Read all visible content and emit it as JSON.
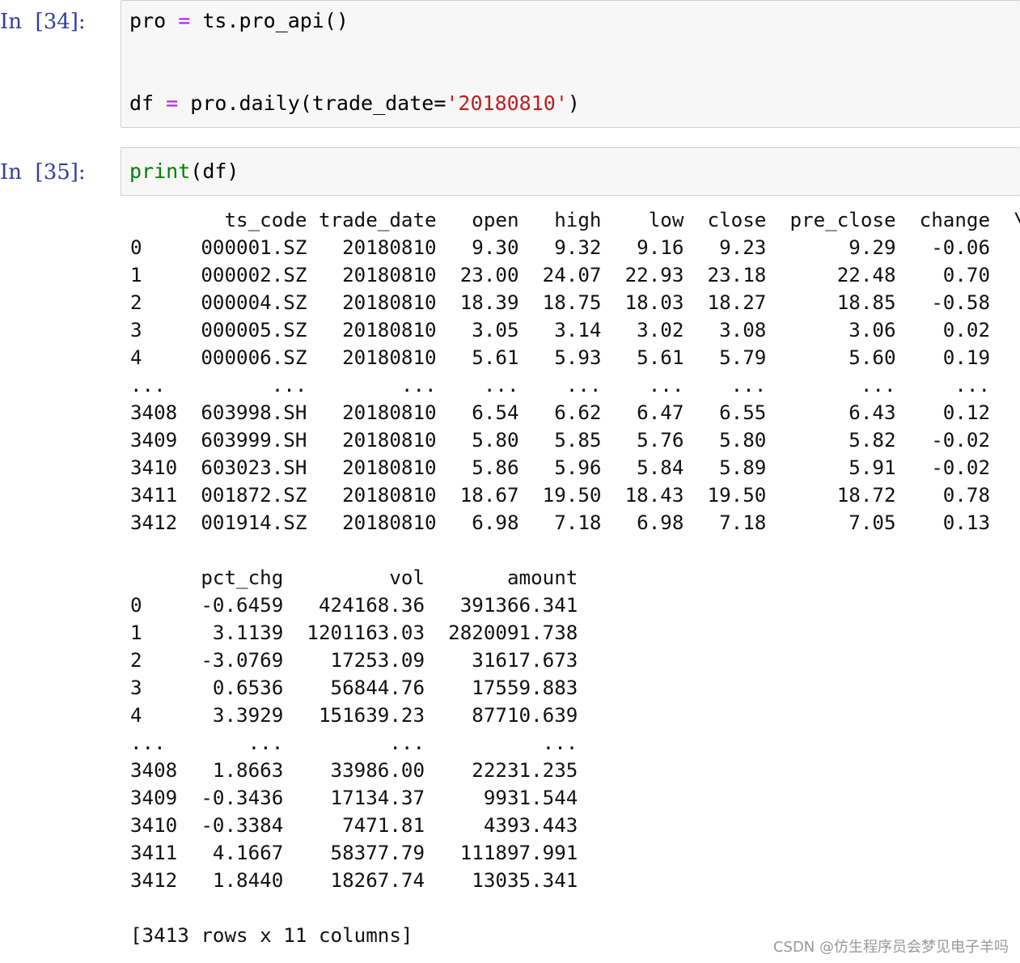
{
  "cells": [
    {
      "prompt": "In  [34]:",
      "code": {
        "line1": {
          "var": "pro",
          "op": "=",
          "rest": "ts.pro_api()"
        },
        "line2": {
          "var": "df",
          "op": "=",
          "call": "pro.daily(trade_date=",
          "string": "'20180810'",
          "close": ")"
        }
      }
    },
    {
      "prompt": "In  [35]:",
      "code": {
        "func": "print",
        "args": "(df)"
      },
      "output": {
        "table1_header": "        ts_code trade_date   open   high    low  close  pre_close  change  \\",
        "table1_rows": [
          "0     000001.SZ   20180810   9.30   9.32   9.16   9.23       9.29   -0.06",
          "1     000002.SZ   20180810  23.00  24.07  22.93  23.18      22.48    0.70",
          "2     000004.SZ   20180810  18.39  18.75  18.03  18.27      18.85   -0.58",
          "3     000005.SZ   20180810   3.05   3.14   3.02   3.08       3.06    0.02",
          "4     000006.SZ   20180810   5.61   5.93   5.61   5.79       5.60    0.19",
          "...         ...        ...    ...    ...    ...    ...        ...     ...",
          "3408  603998.SH   20180810   6.54   6.62   6.47   6.55       6.43    0.12",
          "3409  603999.SH   20180810   5.80   5.85   5.76   5.80       5.82   -0.02",
          "3410  603023.SH   20180810   5.86   5.96   5.84   5.89       5.91   -0.02",
          "3411  001872.SZ   20180810  18.67  19.50  18.43  19.50      18.72    0.78",
          "3412  001914.SZ   20180810   6.98   7.18   6.98   7.18       7.05    0.13"
        ],
        "table2_header": "      pct_chg         vol       amount",
        "table2_rows": [
          "0     -0.6459   424168.36   391366.341",
          "1      3.1139  1201163.03  2820091.738",
          "2     -3.0769    17253.09    31617.673",
          "3      0.6536    56844.76    17559.883",
          "4      3.3929   151639.23    87710.639",
          "...       ...         ...          ...",
          "3408   1.8663    33986.00    22231.235",
          "3409  -0.3436    17134.37     9931.544",
          "3410  -0.3384     7471.81     4393.443",
          "3411   4.1667    58377.79   111897.991",
          "3412   1.8440    18267.74    13035.341"
        ],
        "summary": "[3413 rows x 11 columns]"
      }
    }
  ],
  "watermark": "CSDN @仿生程序员会梦见电子羊吗",
  "colors": {
    "prompt": "#303f9f",
    "operator": "#aa22ff",
    "string": "#ba2121",
    "builtin": "#008000",
    "cell_bg": "#f7f7f7",
    "cell_border": "#cfcfcf"
  }
}
